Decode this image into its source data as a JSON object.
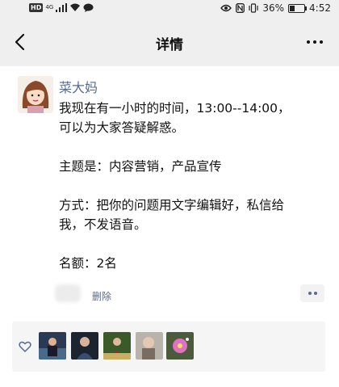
{
  "status_bar": {
    "network_badge": "HD",
    "network_type": "4G",
    "battery_percent": "36%",
    "battery_level": 0.36,
    "time": "4:52",
    "icons": [
      "signal-icon",
      "wifi-icon",
      "message-icon",
      "eye-icon",
      "nfc-icon",
      "vibrate-icon",
      "battery-icon"
    ]
  },
  "nav": {
    "title": "详情",
    "back_icon": "chevron-left-icon",
    "more_icon": "more-icon"
  },
  "post": {
    "username": "菜大妈",
    "content": "我现在有一小时的时间，13:00--14:00，\n可以为大家答疑解惑。\n\n主题是：内容营销，产品宣传\n\n方式：把你的问题用文字编辑好，私信给\n我，不发语音。\n\n名额：2名",
    "delete_label": "删除"
  },
  "likes": {
    "icon": "heart-outline-icon",
    "count": 5
  },
  "colors": {
    "link": "#576b95",
    "background": "#ffffff",
    "bar": "#efefef"
  }
}
